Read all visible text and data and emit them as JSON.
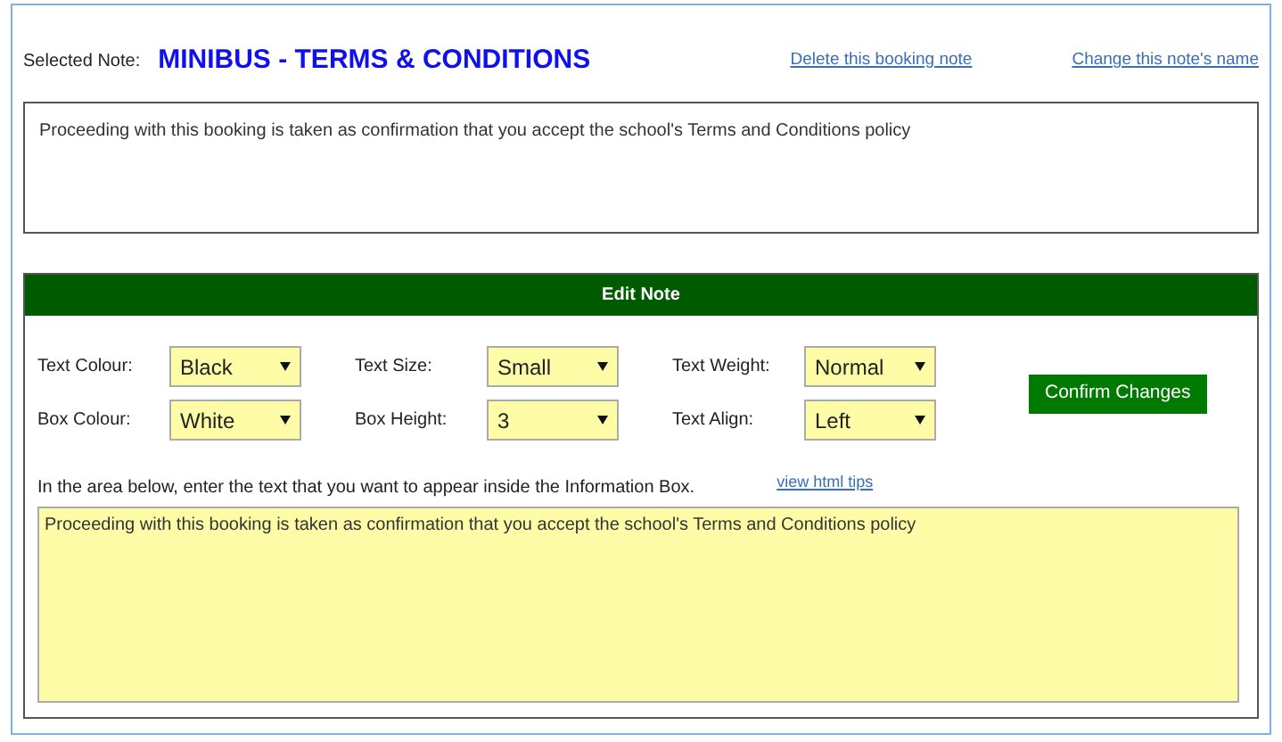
{
  "header": {
    "label": "Selected Note:",
    "title": "MINIBUS - TERMS & CONDITIONS",
    "links": [
      "Delete this booking note",
      "Change this note's name"
    ]
  },
  "preview": {
    "text": "Proceeding with this booking is taken as confirmation that you accept the school's Terms and Conditions policy"
  },
  "edit_panel": {
    "title": "Edit Note",
    "settings": [
      {
        "label": "Text Colour:",
        "value": "Black"
      },
      {
        "label": "Text Size:",
        "value": "Small"
      },
      {
        "label": "Text Weight:",
        "value": "Normal"
      },
      {
        "label": "Box Colour:",
        "value": "White"
      },
      {
        "label": "Box Height:",
        "value": "3"
      },
      {
        "label": "Text Align:",
        "value": "Left"
      }
    ],
    "confirm_button": "Confirm Changes",
    "instruction": "In the area below, enter the text that you want to appear inside the Information Box.",
    "tips_link": "view html tips",
    "editor_text": "Proceeding with this booking is taken as confirmation that you accept the school's Terms and Conditions policy"
  }
}
